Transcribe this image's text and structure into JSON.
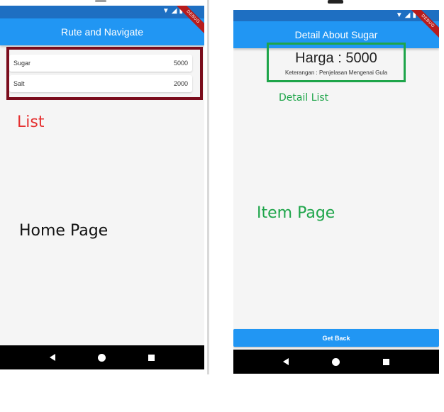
{
  "home": {
    "app_bar_title": "Rute and Navigate",
    "debug_label": "DEBUG",
    "items": [
      {
        "name": "Sugar",
        "price": "5000"
      },
      {
        "name": "Salt",
        "price": "2000"
      }
    ],
    "annotation_list": "List",
    "annotation_page": "Home Page"
  },
  "detail": {
    "app_bar_title": "Detail About Sugar",
    "debug_label": "DEBUG",
    "price_text": "Harga : 5000",
    "description_text": "Keterangan : Penjelasan Mengenai Gula",
    "get_back_label": "Get Back",
    "annotation_detail_list": "Detail List",
    "annotation_page": "Item Page"
  },
  "colors": {
    "app_bar": "#2196f3",
    "status_bar": "#1e6fc2",
    "list_annotation": "#7a0c1c",
    "list_label": "#e53030",
    "detail_annotation": "#1ea54a"
  },
  "icons": {
    "status": [
      "wifi-icon",
      "signal-icon",
      "battery-icon"
    ],
    "nav": [
      "back-icon",
      "home-icon",
      "recent-apps-icon"
    ]
  }
}
